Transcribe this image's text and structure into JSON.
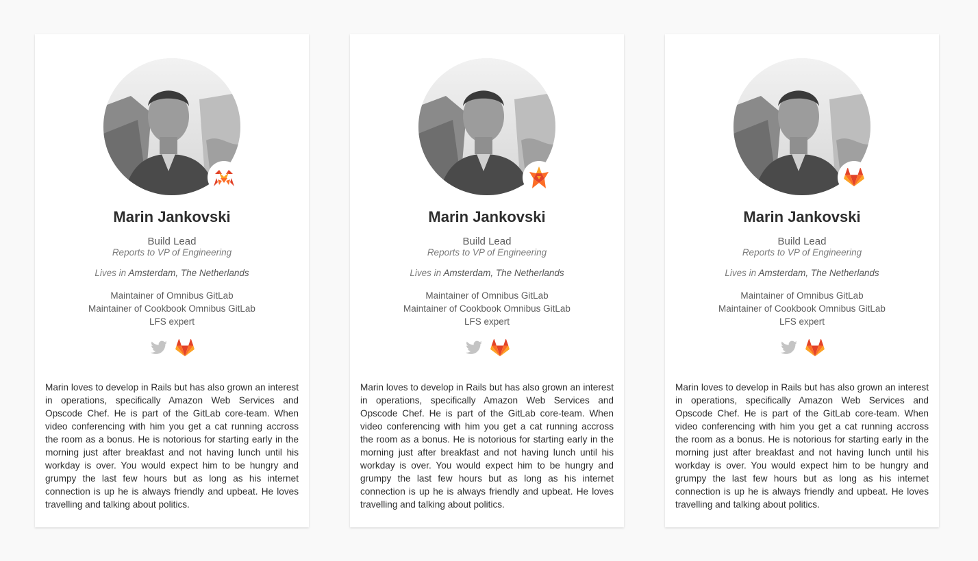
{
  "colors": {
    "background": "#f9f9f9",
    "card": "#ffffff",
    "text": "#2e2e2e",
    "muted": "#7a7a7a",
    "gitlab_orange": "#fc6d26",
    "gitlab_red": "#e24329",
    "gitlab_yellow": "#fca326",
    "twitter_gray": "#c4c4c4"
  },
  "cards": [
    {
      "name": "Marin Jankovski",
      "role": "Build Lead",
      "reports_to": "Reports to VP of Engineering",
      "lives_prefix": "Lives in",
      "location": "Amsterdam, The Netherlands",
      "responsibilities": [
        "Maintainer of Omnibus GitLab",
        "Maintainer of Cookbook Omnibus GitLab",
        "LFS expert"
      ],
      "badge_icon": "tanuki-crab-icon",
      "social": [
        "twitter-icon",
        "gitlab-icon"
      ],
      "bio": "Marin loves to develop in Rails but has also grown an interest in operations, specifically Amazon Web Services and Opscode Chef. He is part of the GitLab core-team. When video conferencing with him you get a cat running accross the room as a bonus. He is notorious for starting early in the morning just after breakfast and not having lunch until his workday is over. You would expect him to be hungry and grumpy the last few hours but as long as his internet connection is up he is always friendly and upbeat. He loves travelling and talking about politics."
    },
    {
      "name": "Marin Jankovski",
      "role": "Build Lead",
      "reports_to": "Reports to VP of Engineering",
      "lives_prefix": "Lives in",
      "location": "Amsterdam, The Netherlands",
      "responsibilities": [
        "Maintainer of Omnibus GitLab",
        "Maintainer of Cookbook Omnibus GitLab",
        "LFS expert"
      ],
      "badge_icon": "tanuki-star-icon",
      "social": [
        "twitter-icon",
        "gitlab-icon"
      ],
      "bio": "Marin loves to develop in Rails but has also grown an interest in operations, specifically Amazon Web Services and Opscode Chef. He is part of the GitLab core-team. When video conferencing with him you get a cat running accross the room as a bonus. He is notorious for starting early in the morning just after breakfast and not having lunch until his workday is over. You would expect him to be hungry and grumpy the last few hours but as long as his internet connection is up he is always friendly and upbeat. He loves travelling and talking about politics."
    },
    {
      "name": "Marin Jankovski",
      "role": "Build Lead",
      "reports_to": "Reports to VP of Engineering",
      "lives_prefix": "Lives in",
      "location": "Amsterdam, The Netherlands",
      "responsibilities": [
        "Maintainer of Omnibus GitLab",
        "Maintainer of Cookbook Omnibus GitLab",
        "LFS expert"
      ],
      "badge_icon": "tanuki-icon",
      "social": [
        "twitter-icon",
        "gitlab-icon"
      ],
      "bio": "Marin loves to develop in Rails but has also grown an interest in operations, specifically Amazon Web Services and Opscode Chef. He is part of the GitLab core-team. When video conferencing with him you get a cat running accross the room as a bonus. He is notorious for starting early in the morning just after breakfast and not having lunch until his workday is over. You would expect him to be hungry and grumpy the last few hours but as long as his internet connection is up he is always friendly and upbeat. He loves travelling and talking about politics."
    }
  ]
}
